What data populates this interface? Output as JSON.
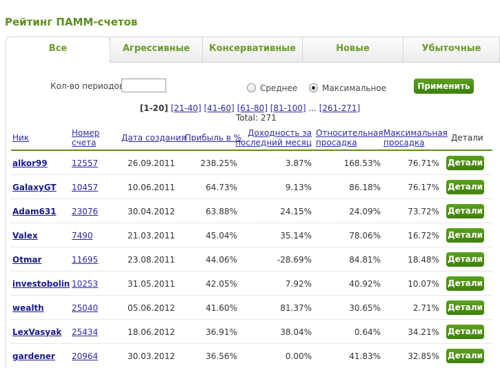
{
  "page_title": "Рейтинг ПАММ-счетов",
  "tabs": [
    "Все",
    "Агрессивные",
    "Консервативные",
    "Новые",
    "Убыточные"
  ],
  "active_tab": "Все",
  "filters": {
    "period_label": "Кол-во периодов",
    "period_value": "",
    "radio_average": "Среднее",
    "radio_max": "Максимальное",
    "selected": "Максимальное",
    "apply_label": "Применить"
  },
  "pager": {
    "current": "[1-20]",
    "pages": [
      "[21-40]",
      "[41-60]",
      "[61-80]",
      "[81-100]"
    ],
    "ellipsis": "...",
    "last": "[261-271]",
    "total": "Total: 271"
  },
  "columns": {
    "nick": "Ник",
    "account_1": "Номер",
    "account_2": "счета",
    "created": "Дата создания",
    "profit": "Прибыль в %",
    "monthly_1": "Доходность за",
    "monthly_2": "последний месяц",
    "rel_dd_1": "Относительная",
    "rel_dd_2": "просадка",
    "max_dd_1": "Максимальная",
    "max_dd_2": "просадка",
    "details": "Детали"
  },
  "details_label": "Детали",
  "rows": [
    {
      "nick": "alkor99",
      "account": "12557",
      "created": "26.09.2011",
      "profit": "238.25%",
      "monthly": "3.87%",
      "rel_dd": "168.53%",
      "max_dd": "76.71%"
    },
    {
      "nick": "GalaxyGT",
      "account": "10457",
      "created": "10.06.2011",
      "profit": "64.73%",
      "monthly": "9.13%",
      "rel_dd": "86.18%",
      "max_dd": "76.17%"
    },
    {
      "nick": "Adam631",
      "account": "23076",
      "created": "30.04.2012",
      "profit": "63.88%",
      "monthly": "24.15%",
      "rel_dd": "24.09%",
      "max_dd": "73.72%"
    },
    {
      "nick": "Valex",
      "account": "7490",
      "created": "21.03.2011",
      "profit": "45.04%",
      "monthly": "35.14%",
      "rel_dd": "78.06%",
      "max_dd": "16.72%"
    },
    {
      "nick": "Otmar",
      "account": "11695",
      "created": "23.08.2011",
      "profit": "44.06%",
      "monthly": "-28.69%",
      "rel_dd": "84.81%",
      "max_dd": "18.48%"
    },
    {
      "nick": "investobolin",
      "account": "10253",
      "created": "31.05.2011",
      "profit": "42.05%",
      "monthly": "7.92%",
      "rel_dd": "40.92%",
      "max_dd": "10.07%"
    },
    {
      "nick": "wealth",
      "account": "25040",
      "created": "05.06.2012",
      "profit": "41.60%",
      "monthly": "81.37%",
      "rel_dd": "30.65%",
      "max_dd": "2.71%"
    },
    {
      "nick": "LexVasyak",
      "account": "25434",
      "created": "18.06.2012",
      "profit": "36.91%",
      "monthly": "38.04%",
      "rel_dd": "0.64%",
      "max_dd": "34.21%"
    },
    {
      "nick": "gardener",
      "account": "20964",
      "created": "30.03.2012",
      "profit": "36.56%",
      "monthly": "0.00%",
      "rel_dd": "41.83%",
      "max_dd": "32.85%"
    }
  ]
}
